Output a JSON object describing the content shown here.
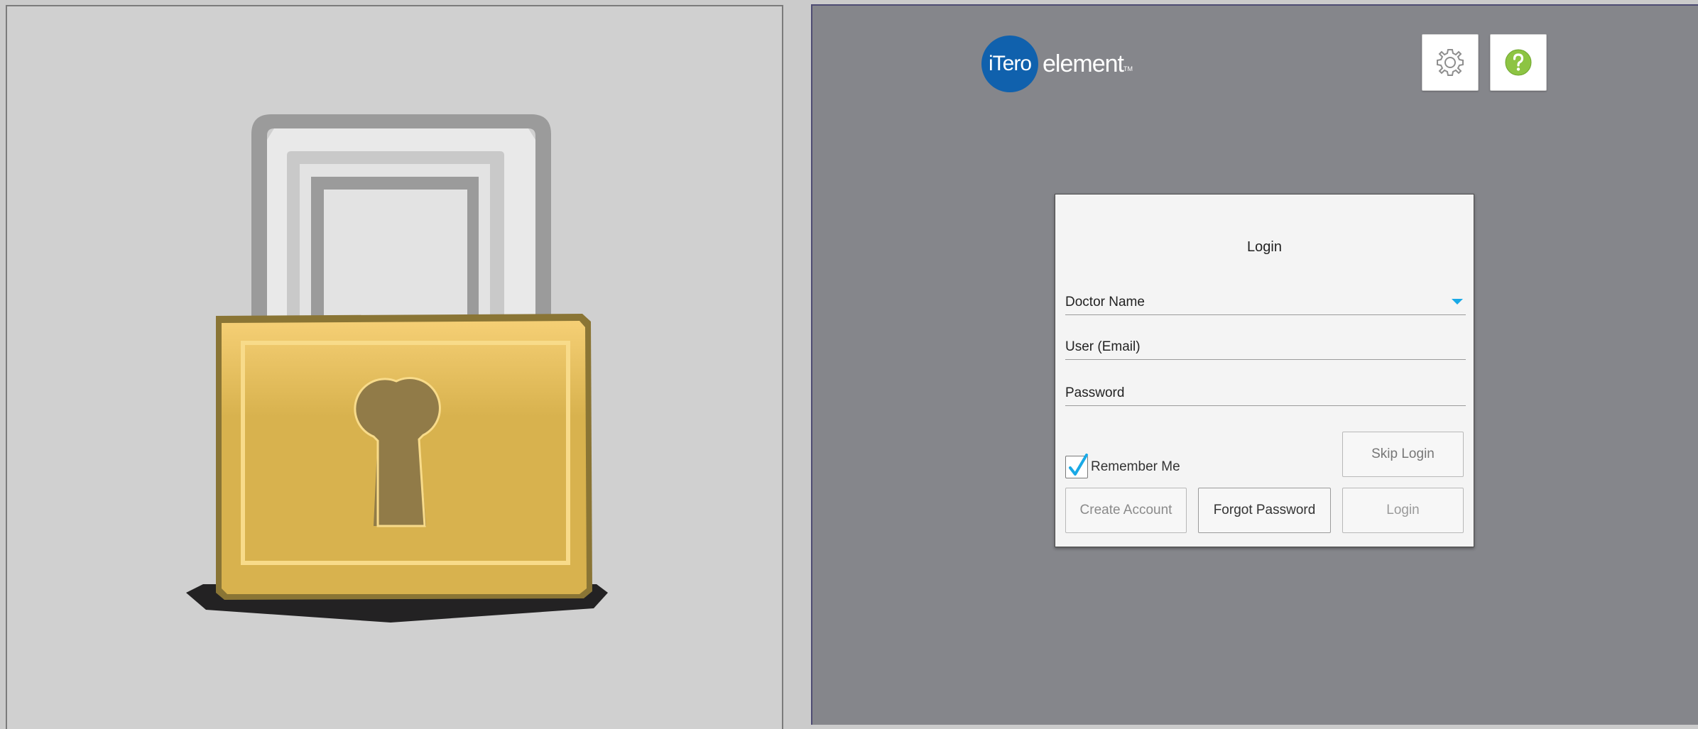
{
  "lock_illustration": {
    "icon": "padlock-icon",
    "colors": {
      "shackle": "#9b9b9b",
      "body": "#dcb651",
      "body_outline": "#8a7535",
      "keyhole": "#917b48",
      "shadow": "#222222"
    }
  },
  "header": {
    "logo": {
      "badge_text": "iTero",
      "word": "element",
      "tm": "TM",
      "badge_color": "#1061ad"
    },
    "settings_icon": "gear-icon",
    "help_icon": "question-mark-icon"
  },
  "login": {
    "title": "Login",
    "fields": {
      "doctor_name": "Doctor Name",
      "user_email": "User (Email)",
      "password": "Password"
    },
    "remember_me": {
      "label": "Remember Me",
      "checked": true
    },
    "buttons": {
      "skip_login": "Skip Login",
      "create_account": "Create Account",
      "forgot_password": "Forgot Password",
      "login": "Login"
    },
    "accent_color": "#19a9e6"
  }
}
